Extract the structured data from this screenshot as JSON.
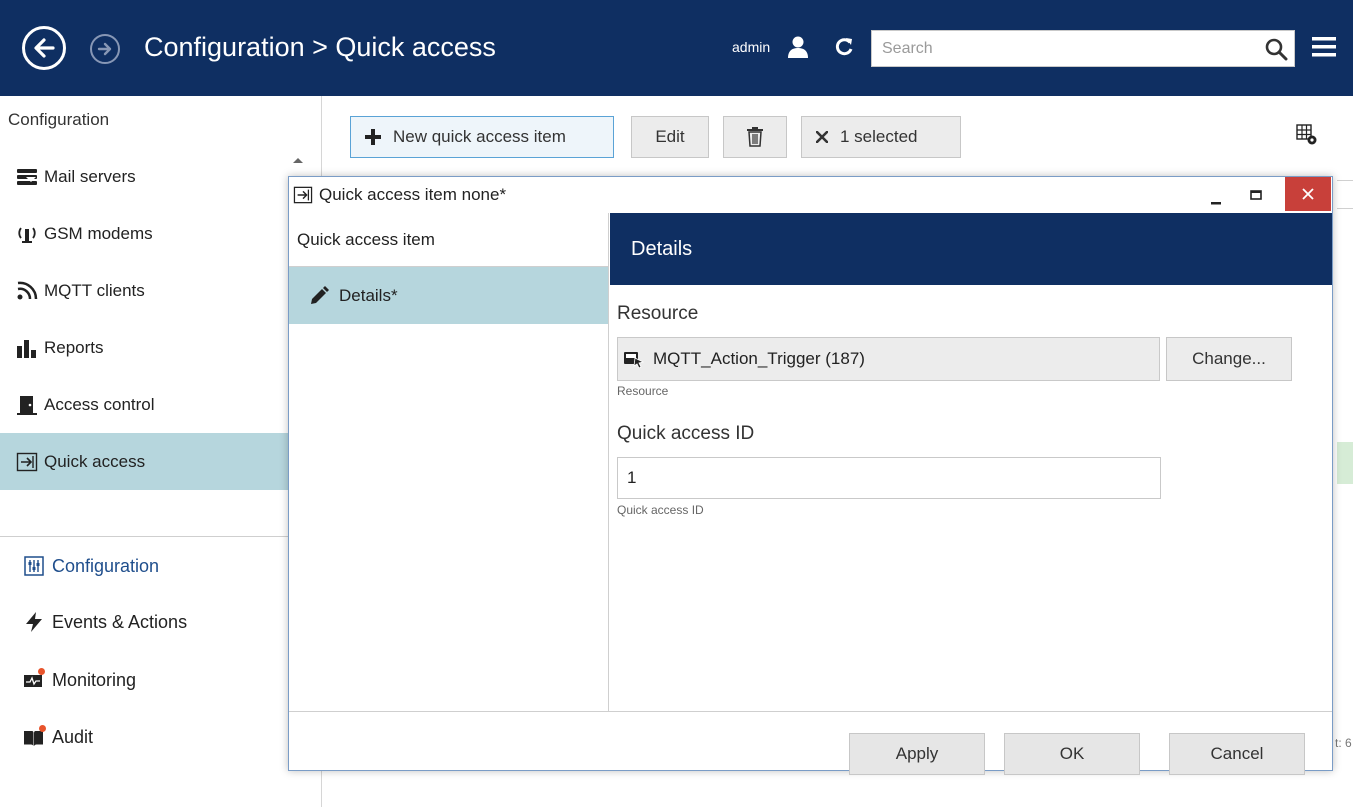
{
  "header": {
    "title": "Configuration > Quick access",
    "user": "admin",
    "search_placeholder": "Search"
  },
  "sidebar": {
    "heading": "Configuration",
    "items": [
      {
        "label": "Mail servers",
        "icon": "mail-servers-icon"
      },
      {
        "label": "GSM modems",
        "icon": "gsm-modem-icon"
      },
      {
        "label": "MQTT clients",
        "icon": "mqtt-icon"
      },
      {
        "label": "Reports",
        "icon": "reports-icon"
      },
      {
        "label": "Access control",
        "icon": "door-icon"
      },
      {
        "label": "Quick access",
        "icon": "quick-access-icon",
        "active": true
      }
    ],
    "nav": [
      {
        "label": "Configuration",
        "icon": "configuration-icon",
        "current": true
      },
      {
        "label": "Events & Actions",
        "icon": "lightning-icon"
      },
      {
        "label": "Monitoring",
        "icon": "monitoring-icon"
      },
      {
        "label": "Audit",
        "icon": "audit-book-icon"
      }
    ]
  },
  "toolbar": {
    "new_label": "New quick access item",
    "edit_label": "Edit",
    "selected_label": "1 selected"
  },
  "background": {
    "count_fragment": "t: 6"
  },
  "dialog": {
    "title": "Quick access item none*",
    "left_heading": "Quick access item",
    "left_item": "Details*",
    "details_title": "Details",
    "resource_label": "Resource",
    "resource_value": "MQTT_Action_Trigger (187)",
    "resource_hint": "Resource",
    "change_label": "Change...",
    "id_label": "Quick access ID",
    "id_value": "1",
    "id_hint": "Quick access ID",
    "apply_label": "Apply",
    "ok_label": "OK",
    "cancel_label": "Cancel"
  },
  "colors": {
    "header_bg": "#0f2f62",
    "active_row": "#b6d6dd",
    "close_button": "#c8403a"
  }
}
